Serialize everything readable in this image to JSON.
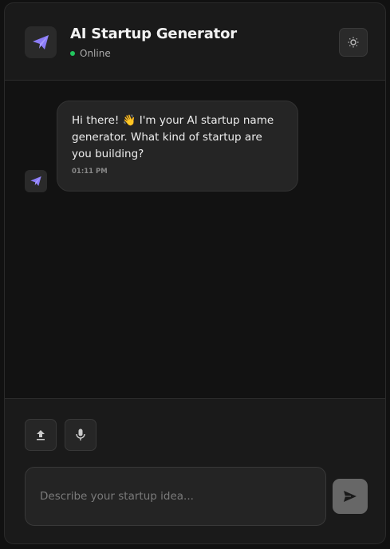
{
  "header": {
    "title": "AI Startup Generator",
    "status": "Online",
    "logo_icon": "paper-plane-icon",
    "theme_icon": "sun-icon"
  },
  "colors": {
    "accent": "#8b7cf6",
    "online": "#22c55e"
  },
  "messages": [
    {
      "sender": "bot",
      "text": "Hi there! 👋 I'm your AI startup name generator. What kind of startup are you building?",
      "time": "01:11 PM"
    }
  ],
  "composer": {
    "placeholder": "Describe your startup idea...",
    "value": "",
    "upload_icon": "upload-icon",
    "mic_icon": "microphone-icon",
    "send_icon": "send-icon"
  }
}
